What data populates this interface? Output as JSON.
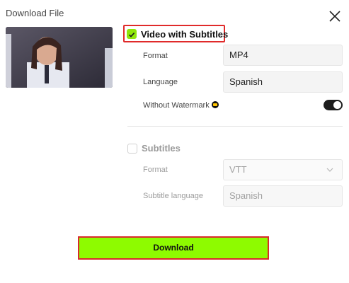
{
  "dialog": {
    "title": "Download File"
  },
  "video_section": {
    "label": "Video with Subtitles",
    "checked": true,
    "format_label": "Format",
    "format_value": "MP4",
    "language_label": "Language",
    "language_value": "Spanish",
    "watermark_label": "Without Watermark",
    "watermark_enabled": true
  },
  "subtitles_section": {
    "label": "Subtitles",
    "checked": false,
    "format_label": "Format",
    "format_value": "VTT",
    "language_label": "Subtitle language",
    "language_value": "Spanish"
  },
  "actions": {
    "download_label": "Download"
  },
  "colors": {
    "accent": "#8efb00",
    "highlight_border": "#e02a2a"
  },
  "icons": {
    "close": "close-icon",
    "check": "checkmark-icon",
    "premium": "crown-icon",
    "dropdown": "chevron-down-icon"
  }
}
